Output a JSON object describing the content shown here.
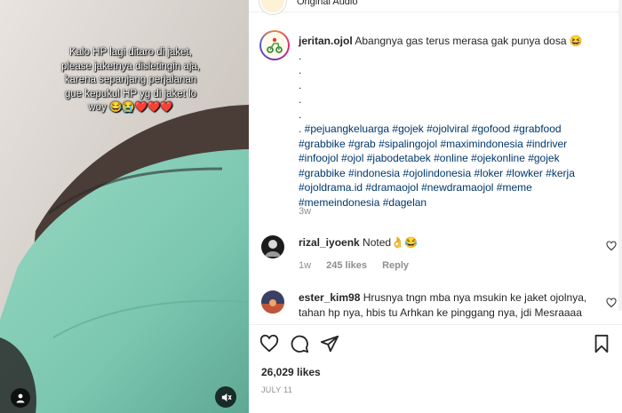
{
  "header": {
    "audio_label": "Original Audio"
  },
  "video": {
    "overlay_text": "Kalo HP lagi ditaro di jaket, please jaketnya disletingin aja, karena sepanjang perjalanan gue kepukul HP yg di jaket lo woy 😂😭❤️❤️❤️",
    "tag_icon": "user-icon",
    "mute_icon": "speaker-muted-icon"
  },
  "post": {
    "username": "jeritan.ojol",
    "caption_text": "Abangnya gas terus merasa gak punya dosa 😆",
    "dots": [
      ".",
      ".",
      ".",
      ".",
      "."
    ],
    "hashtags": ". #pejuangkeluarga #gojek #ojolviral #gofood #grabfood #grabbike #grab #sipalingojol #maximindonesia #indriver #infoojol #ojol #jabodetabek #online #ojekonline #gojek #grabbike #indonesia #ojolindonesia #loker #lowker #kerja #ojoldrama.id #dramaojol #newdramaojol #meme #memeindonesia #dagelan",
    "time_ago": "3w"
  },
  "comments": [
    {
      "username": "rizal_iyoenk",
      "text": "Noted👌😂",
      "time": "1w",
      "likes": "245 likes",
      "reply": "Reply"
    },
    {
      "username": "ester_kim98",
      "text": "Hrusnya tngn mba nya msukin ke jaket ojolnya, tahan hp nya, hbis tu Arhkan ke pinggang nya, jdi Mesraaaa"
    }
  ],
  "actions": {
    "icons": [
      "heart-icon",
      "comment-icon",
      "share-icon",
      "bookmark-icon"
    ]
  },
  "likes_count": "26,029 likes",
  "post_date": "JULY 11",
  "colors": {
    "hashtag": "#00376b",
    "muted": "#8e8e8e",
    "text": "#262626"
  }
}
